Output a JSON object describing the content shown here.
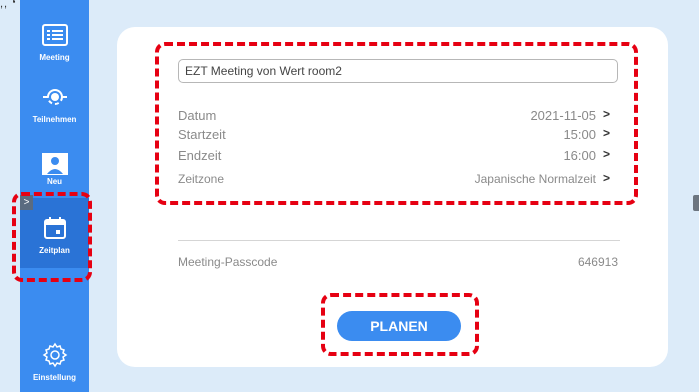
{
  "sidebar": {
    "items": [
      {
        "label": "Meeting",
        "icon": "list-icon"
      },
      {
        "label": "Teilnehmen",
        "icon": "join-icon"
      },
      {
        "label": "Neu",
        "icon": "person-screen-icon"
      },
      {
        "label": "Zeitplan",
        "icon": "calendar-icon"
      },
      {
        "label": "Einstellung",
        "icon": "gear-icon"
      }
    ]
  },
  "form": {
    "meeting_name": "EZT Meeting von Wert room2",
    "rows": [
      {
        "key": "Datum",
        "value": "2021-11-05"
      },
      {
        "key": "Startzeit",
        "value": "15:00"
      },
      {
        "key": "Endzeit",
        "value": "16:00"
      },
      {
        "key": "Zeitzone",
        "value": "Japanische Normalzeit"
      }
    ],
    "passcode_label": "Meeting-Passcode",
    "passcode_value": "646913",
    "plan_button": "PLANEN"
  },
  "chevron": ">",
  "collapse": ">",
  "colors": {
    "accent": "#3b8cf0",
    "highlight": "#e60012",
    "background": "#dcebf9"
  }
}
